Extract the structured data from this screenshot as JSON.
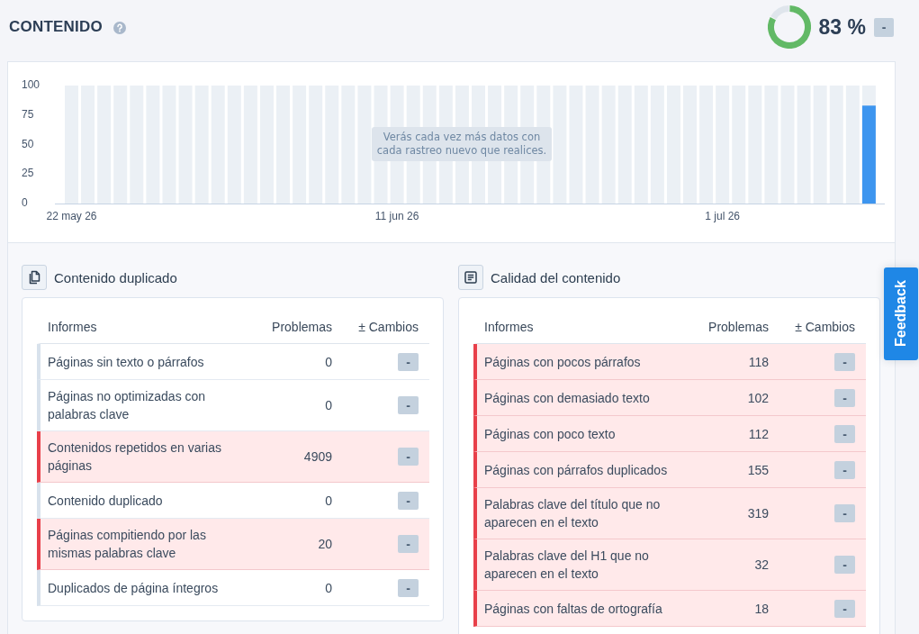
{
  "header": {
    "title": "CONTENIDO",
    "score": {
      "level": 0.83,
      "reading": "83 %",
      "change": "-"
    }
  },
  "chart": {
    "notice": "Verás cada vez más datos con cada rastreo nuevo que realices.",
    "chart_data": {
      "type": "bar",
      "categories": [
        "22 may 26",
        null,
        null,
        null,
        null,
        null,
        null,
        null,
        null,
        null,
        null,
        null,
        null,
        null,
        null,
        null,
        null,
        null,
        null,
        null,
        "11 jun 26",
        null,
        null,
        null,
        null,
        null,
        null,
        null,
        null,
        null,
        null,
        null,
        null,
        null,
        null,
        null,
        null,
        null,
        null,
        null,
        "1 jul 26",
        null,
        null,
        null,
        null,
        null,
        null,
        null,
        null,
        null
      ],
      "values": [
        null,
        null,
        null,
        null,
        null,
        null,
        null,
        null,
        null,
        null,
        null,
        null,
        null,
        null,
        null,
        null,
        null,
        null,
        null,
        null,
        null,
        null,
        null,
        null,
        null,
        null,
        null,
        null,
        null,
        null,
        null,
        null,
        null,
        null,
        null,
        null,
        null,
        null,
        null,
        null,
        null,
        null,
        null,
        null,
        null,
        null,
        null,
        null,
        null,
        83
      ],
      "ylim": [
        0,
        100
      ],
      "yticks": [
        0,
        25,
        50,
        75,
        100
      ]
    }
  },
  "sections": [
    {
      "kind": "duplicate",
      "title": "Contenido duplicado",
      "table": {
        "columns": [
          "Informes",
          "Problemas",
          "± Cambios"
        ],
        "rows": [
          {
            "report": "Páginas sin texto o párrafos",
            "problems": "0",
            "change": "-",
            "flagged": false
          },
          {
            "report": "Páginas no optimizadas con palabras clave",
            "problems": "0",
            "change": "-",
            "flagged": false
          },
          {
            "report": "Contenidos repetidos en varias páginas",
            "problems": "4909",
            "change": "-",
            "flagged": true
          },
          {
            "report": "Contenido duplicado",
            "problems": "0",
            "change": "-",
            "flagged": false
          },
          {
            "report": "Páginas compitiendo por las mismas palabras clave",
            "problems": "20",
            "change": "-",
            "flagged": true
          },
          {
            "report": "Duplicados de página íntegros",
            "problems": "0",
            "change": "-",
            "flagged": false
          }
        ]
      }
    },
    {
      "kind": "quality",
      "title": "Calidad del contenido",
      "table": {
        "columns": [
          "Informes",
          "Problemas",
          "± Cambios"
        ],
        "rows": [
          {
            "report": "Páginas con pocos párrafos",
            "problems": "118",
            "change": "-",
            "flagged": true
          },
          {
            "report": "Páginas con demasiado texto",
            "problems": "102",
            "change": "-",
            "flagged": true
          },
          {
            "report": "Páginas con poco texto",
            "problems": "112",
            "change": "-",
            "flagged": true
          },
          {
            "report": "Páginas con párrafos duplicados",
            "problems": "155",
            "change": "-",
            "flagged": true
          },
          {
            "report": "Palabras clave del título que no aparecen en el texto",
            "problems": "319",
            "change": "-",
            "flagged": true
          },
          {
            "report": "Palabras clave del H1 que no aparecen en el texto",
            "problems": "32",
            "change": "-",
            "flagged": true
          },
          {
            "report": "Páginas con faltas de ortografía",
            "problems": "18",
            "change": "-",
            "flagged": true
          }
        ]
      }
    }
  ],
  "feedback_button": {
    "label": "Feedback"
  }
}
